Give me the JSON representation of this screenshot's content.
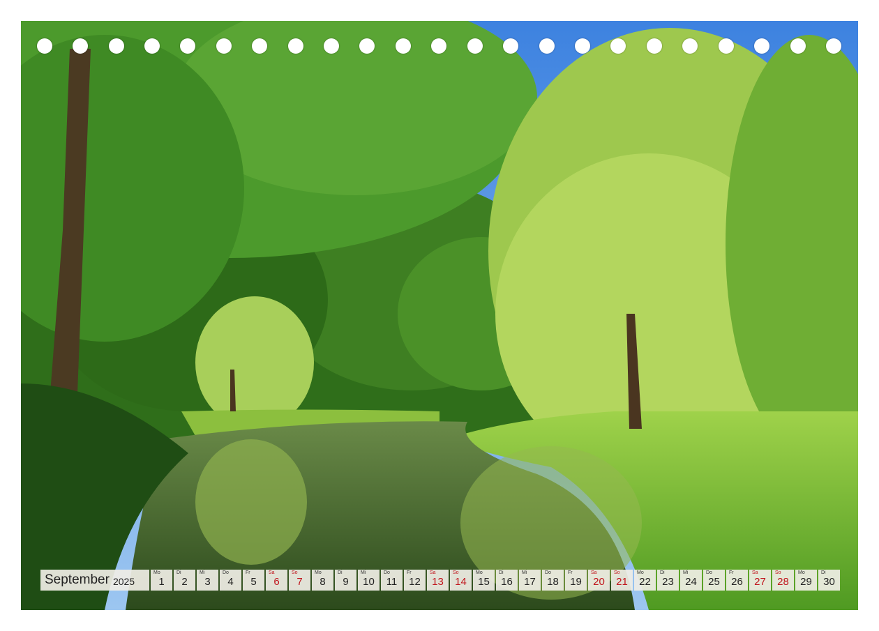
{
  "calendar": {
    "month": "September",
    "year": "2025",
    "weekend_color": "#c0141c",
    "days": [
      {
        "wd": "Mo",
        "num": "1",
        "weekend": false
      },
      {
        "wd": "Di",
        "num": "2",
        "weekend": false
      },
      {
        "wd": "Mi",
        "num": "3",
        "weekend": false
      },
      {
        "wd": "Do",
        "num": "4",
        "weekend": false
      },
      {
        "wd": "Fr",
        "num": "5",
        "weekend": false
      },
      {
        "wd": "Sa",
        "num": "6",
        "weekend": true
      },
      {
        "wd": "So",
        "num": "7",
        "weekend": true
      },
      {
        "wd": "Mo",
        "num": "8",
        "weekend": false
      },
      {
        "wd": "Di",
        "num": "9",
        "weekend": false
      },
      {
        "wd": "Mi",
        "num": "10",
        "weekend": false
      },
      {
        "wd": "Do",
        "num": "11",
        "weekend": false
      },
      {
        "wd": "Fr",
        "num": "12",
        "weekend": false
      },
      {
        "wd": "Sa",
        "num": "13",
        "weekend": true
      },
      {
        "wd": "So",
        "num": "14",
        "weekend": true
      },
      {
        "wd": "Mo",
        "num": "15",
        "weekend": false
      },
      {
        "wd": "Di",
        "num": "16",
        "weekend": false
      },
      {
        "wd": "Mi",
        "num": "17",
        "weekend": false
      },
      {
        "wd": "Do",
        "num": "18",
        "weekend": false
      },
      {
        "wd": "Fr",
        "num": "19",
        "weekend": false
      },
      {
        "wd": "Sa",
        "num": "20",
        "weekend": true
      },
      {
        "wd": "So",
        "num": "21",
        "weekend": true
      },
      {
        "wd": "Mo",
        "num": "22",
        "weekend": false
      },
      {
        "wd": "Di",
        "num": "23",
        "weekend": false
      },
      {
        "wd": "Mi",
        "num": "24",
        "weekend": false
      },
      {
        "wd": "Do",
        "num": "25",
        "weekend": false
      },
      {
        "wd": "Fr",
        "num": "26",
        "weekend": false
      },
      {
        "wd": "Sa",
        "num": "27",
        "weekend": true
      },
      {
        "wd": "So",
        "num": "28",
        "weekend": true
      },
      {
        "wd": "Mo",
        "num": "29",
        "weekend": false
      },
      {
        "wd": "Di",
        "num": "30",
        "weekend": false
      }
    ]
  },
  "photo": {
    "subject": "park-pond-with-weeping-willows",
    "sky_color": "#4f8fe0",
    "foliage_color": "#3f8a1f",
    "water_color": "#4a6a2a"
  },
  "binding": {
    "hole_count": 23
  }
}
